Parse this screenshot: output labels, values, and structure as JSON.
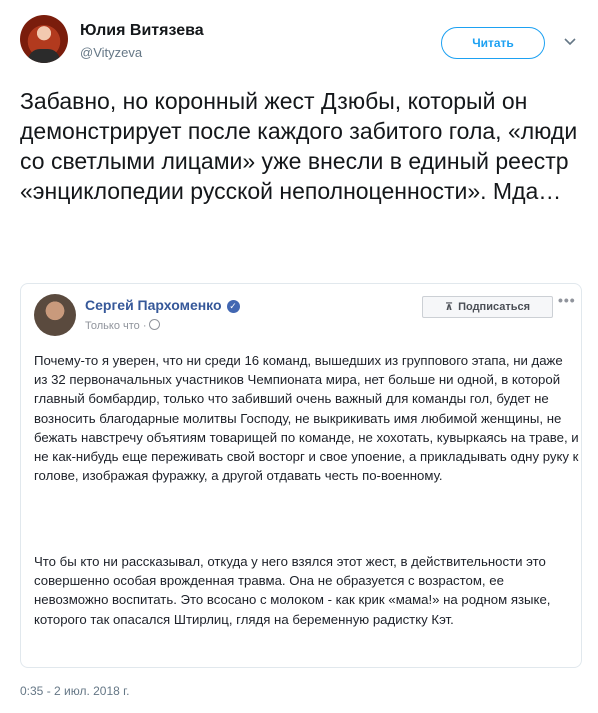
{
  "author": {
    "name": "Юлия Витязева",
    "handle": "@Vityzeva"
  },
  "follow_button": {
    "label": "Читать"
  },
  "icons": {
    "more": "chevron-down-icon",
    "verified": "verified-check-icon",
    "globe": "globe-icon",
    "rss": "rss-icon"
  },
  "tweet": {
    "text": "Забавно, но коронный жест Дзюбы, который он демонстрирует после каждого забитого гола, «люди со светлыми лицами» уже внесли в единый реестр «энциклопедии русской неполноценности». Мда…",
    "timestamp": "0:35 - 2 июл. 2018 г."
  },
  "embedded_post": {
    "author": "Сергей Пархоменко",
    "time": "Только что ·",
    "subscribe_label": "Подписаться",
    "more_label": "•••",
    "paragraph1": "Почему-то я уверен, что ни среди 16 команд, вышедших из группового этапа, ни даже из 32 первоначальных участников Чемпионата мира, нет больше ни одной, в которой главный бомбардир, только что забивший очень важный для команды гол, будет не возносить благодарные молитвы Господу, не выкрикивать имя любимой женщины, не бежать навстречу объятиям товарищей по команде, не хохотать, кувыркаясь на траве, и не как-нибудь еще переживать свой восторг и свое упоение, а прикладывать одну руку к голове, изображая фуражку, а другой отдавать честь по-военному.",
    "paragraph2": "Что бы кто ни рассказывал, откуда у него взялся этот жест, в действительности это совершенно особая врожденная травма. Она не образуется с возрастом, ее невозможно воспитать. Это всосано с молоком - как крик «мама!» на родном языке, которого так опасался Штирлиц, глядя на беременную радистку Кэт."
  },
  "colors": {
    "accent": "#1da1f2",
    "fb_link": "#365899",
    "muted": "#657786"
  }
}
